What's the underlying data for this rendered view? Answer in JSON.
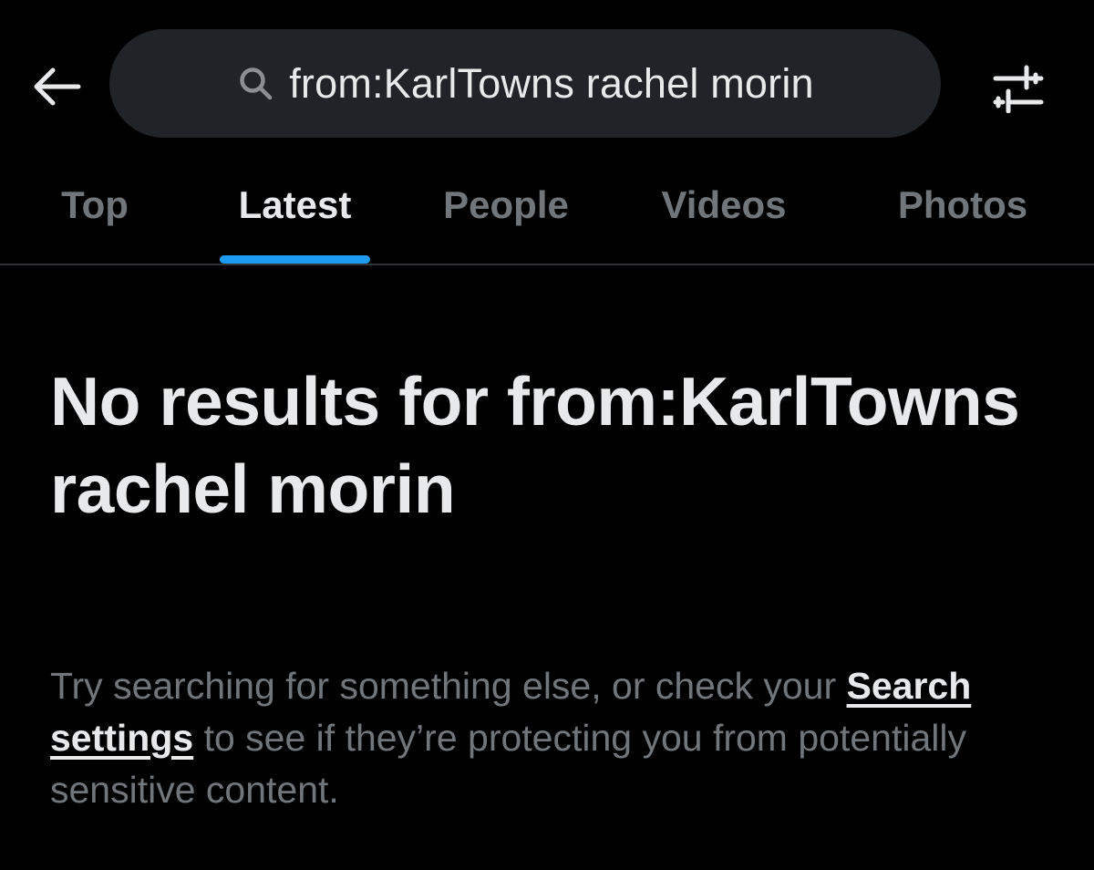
{
  "header": {
    "back_icon": "arrow-left-icon",
    "search": {
      "icon": "search-icon",
      "query": "from:KarlTowns rachel morin"
    },
    "filter_icon": "sliders-icon"
  },
  "tabs": [
    {
      "label": "Top",
      "active": false
    },
    {
      "label": "Latest",
      "active": true
    },
    {
      "label": "People",
      "active": false
    },
    {
      "label": "Videos",
      "active": false
    },
    {
      "label": "Photos",
      "active": false
    }
  ],
  "empty_state": {
    "title": "No results for from:KarlTowns rachel morin",
    "desc_before": "Try searching for something else, or check your ",
    "link_text": "Search settings",
    "desc_after": " to see if they’re protecting you from potentially sensitive content."
  },
  "colors": {
    "background": "#000000",
    "search_pill": "#202327",
    "primary_text": "#e7e9ea",
    "secondary_text": "#71767b",
    "accent": "#1d9bf0",
    "divider": "#2f3336"
  }
}
